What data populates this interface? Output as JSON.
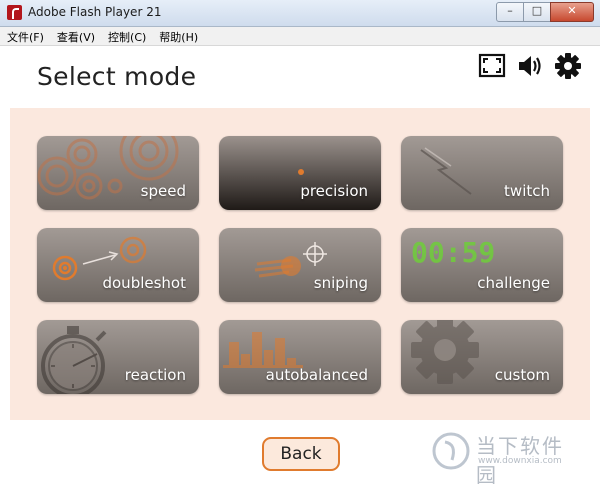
{
  "window": {
    "title": "Adobe Flash Player 21",
    "min_glyph": "–",
    "max_glyph": "□",
    "close_glyph": "✕"
  },
  "menu": [
    "文件(F)",
    "查看(V)",
    "控制(C)",
    "帮助(H)"
  ],
  "page_title": "Select mode",
  "toolbar_icons": [
    "fullscreen-icon",
    "volume-icon",
    "gear-icon"
  ],
  "modes": [
    {
      "label": "speed",
      "icon": "target-rings-icon"
    },
    {
      "label": "precision",
      "icon": "dot-icon"
    },
    {
      "label": "twitch",
      "icon": "streak-icon"
    },
    {
      "label": "doubleshot",
      "icon": "double-target-icon"
    },
    {
      "label": "sniping",
      "icon": "crosshair-icon"
    },
    {
      "label": "challenge",
      "icon": "timer-display-icon",
      "display": "00:59"
    },
    {
      "label": "reaction",
      "icon": "stopwatch-icon"
    },
    {
      "label": "autobalanced",
      "icon": "bars-icon"
    },
    {
      "label": "custom",
      "icon": "gear-icon"
    }
  ],
  "back_label": "Back",
  "watermark": {
    "name": "当下软件园",
    "url": "www.downxia.com"
  },
  "colors": {
    "accent": "#e07b2e",
    "panel": "#fbe8de",
    "tile": "#8a827d",
    "timer": "#6fce3a"
  }
}
